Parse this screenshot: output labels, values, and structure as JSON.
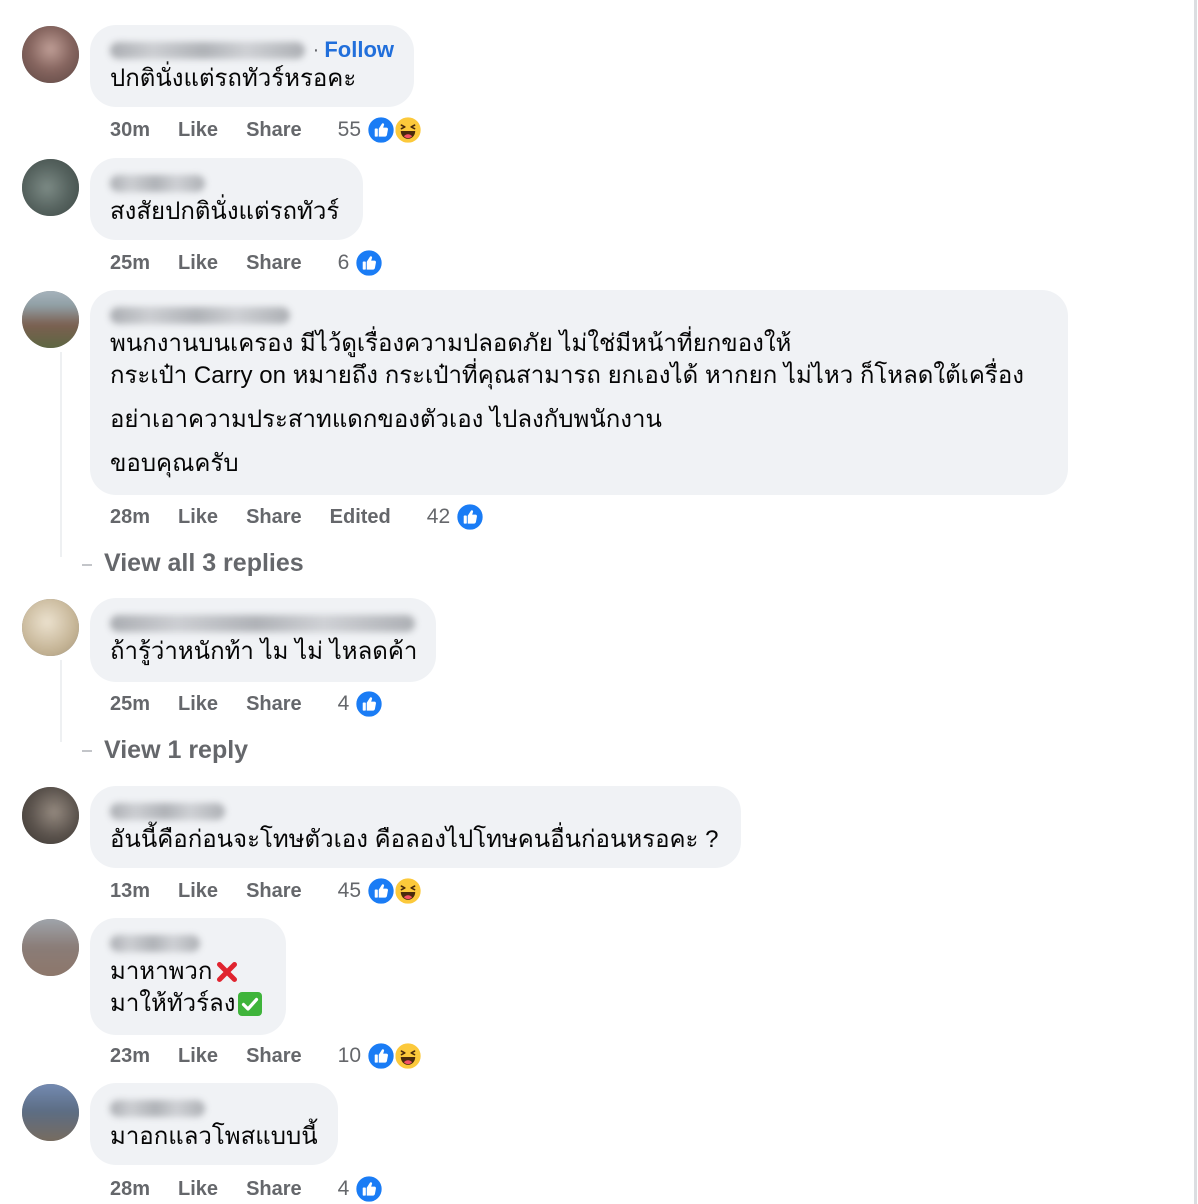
{
  "labels": {
    "like": "Like",
    "share": "Share"
  },
  "colors": {
    "accent_blue": "#1877f2",
    "follow_link": "#216fdb",
    "bubble": "#f0f2f5",
    "secondary_text": "#65676b"
  },
  "comments": [
    {
      "follow": {
        "separator": "·",
        "label": "Follow"
      },
      "lines": [
        "ปกตินั่งแต่รถทัวร์หรอคะ"
      ],
      "time": "30m",
      "count": "55",
      "reactions": [
        "like-reaction-icon",
        "haha-reaction-icon"
      ]
    },
    {
      "lines": [
        "สงสัยปกตินั่งแต่รถทัวร์"
      ],
      "time": "25m",
      "count": "6",
      "reactions": [
        "like-reaction-icon"
      ]
    },
    {
      "lines": [
        "พนกงานบนเครอง มีไว้ดูเรื่องความปลอดภัย ไม่ใช่มีหน้าที่ยกของให้",
        "กระเป๋า Carry on หมายถึง กระเป๋าที่คุณสามารถ ยกเองได้ หากยก ไม่ไหว ก็โหลดใต้เครื่อง",
        "อย่าเอาความประสาทแดกของตัวเอง ไปลงกับพนักงาน",
        "ขอบคุณครับ"
      ],
      "time": "28m",
      "edited": "Edited",
      "count": "42",
      "reactions": [
        "like-reaction-icon"
      ],
      "view_replies": "View all 3 replies"
    },
    {
      "lines": [
        "ถ้ารู้ว่าหนักท้า ไม ไม่ ไหลดค้า"
      ],
      "time": "25m",
      "count": "4",
      "reactions": [
        "like-reaction-icon"
      ],
      "view_replies": "View 1 reply"
    },
    {
      "lines": [
        "อันนี้คือก่อนจะโทษตัวเอง คือลองไปโทษคนอื่นก่อนหรอคะ ?"
      ],
      "time": "13m",
      "count": "45",
      "reactions": [
        "like-reaction-icon",
        "haha-reaction-icon"
      ]
    },
    {
      "lines": [
        {
          "text": "มาหาพวก",
          "icon": "cross-mark-icon"
        },
        {
          "text": "มาให้ทัวร์ลง",
          "icon": "check-mark-icon"
        }
      ],
      "time": "23m",
      "count": "10",
      "reactions": [
        "like-reaction-icon",
        "haha-reaction-icon"
      ]
    },
    {
      "lines": [
        "มาอกแลวโพสแบบนี้"
      ],
      "time": "28m",
      "count": "4",
      "reactions": [
        "like-reaction-icon"
      ]
    }
  ]
}
